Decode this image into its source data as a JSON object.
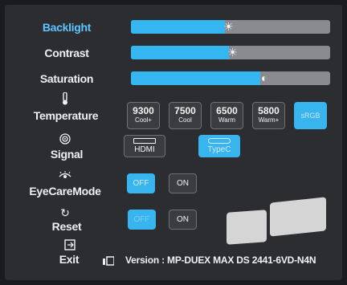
{
  "menu": {
    "backlight": {
      "label": "Backlight",
      "level": 0.47,
      "icon": "sun-icon"
    },
    "contrast": {
      "label": "Contrast",
      "level": 0.49,
      "icon": "sun-icon"
    },
    "saturation": {
      "label": "Saturation",
      "level": 0.65,
      "icon": "half-circle-icon"
    },
    "temperature": {
      "label": "Temperature",
      "icon": "thermometer-icon",
      "options": [
        {
          "value": "9300",
          "sub": "Cool+"
        },
        {
          "value": "7500",
          "sub": "Cool"
        },
        {
          "value": "6500",
          "sub": "Warm"
        },
        {
          "value": "5800",
          "sub": "Warm+"
        },
        {
          "value": "sRGB",
          "sub": ""
        }
      ],
      "selected": "sRGB"
    },
    "signal": {
      "label": "Signal",
      "icon": "signal-icon",
      "options": [
        "HDMI",
        "TypeC"
      ],
      "selected": "TypeC"
    },
    "eyecare": {
      "label": "EyeCareMode",
      "icon": "eye-icon",
      "off": "OFF",
      "on": "ON",
      "selected": "OFF"
    },
    "reset": {
      "label": "Reset",
      "icon": "reset-icon",
      "off": "OFF",
      "on": "ON",
      "selected": "OFF"
    },
    "exit": {
      "label": "Exit",
      "icon": "exit-icon"
    }
  },
  "footer": {
    "version": "Version : MP-DUEX MAX DS 2441-6VD-N4N"
  },
  "colors": {
    "accent": "#38b4ef",
    "panel": "#2c2d30",
    "track": "#8a8b8e"
  }
}
